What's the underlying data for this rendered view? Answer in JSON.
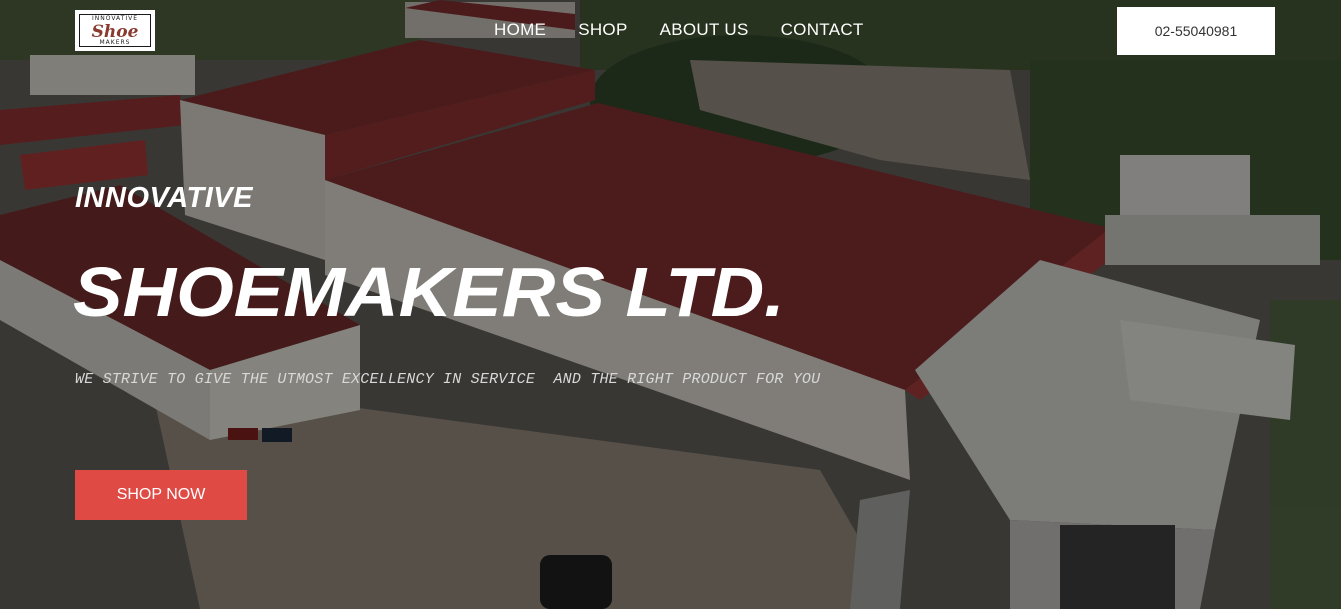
{
  "logo": {
    "top_text": "INNOVATIVE",
    "main_text": "Shoe",
    "bottom_text": "MAKERS"
  },
  "nav": {
    "items": [
      {
        "label": "HOME"
      },
      {
        "label": "SHOP"
      },
      {
        "label": "ABOUT US"
      },
      {
        "label": "CONTACT"
      }
    ]
  },
  "header": {
    "phone": "02-55040981"
  },
  "hero": {
    "kicker": "INNOVATIVE",
    "title": "SHOEMAKERS LTD.",
    "tagline": "WE STRIVE TO GIVE THE UTMOST EXCELLENCY IN SERVICE  AND THE RIGHT PRODUCT FOR YOU",
    "cta_label": "SHOP NOW"
  },
  "colors": {
    "cta_background": "#e04a45",
    "roof_red": "#7a2a2a",
    "text": "#ffffff"
  }
}
